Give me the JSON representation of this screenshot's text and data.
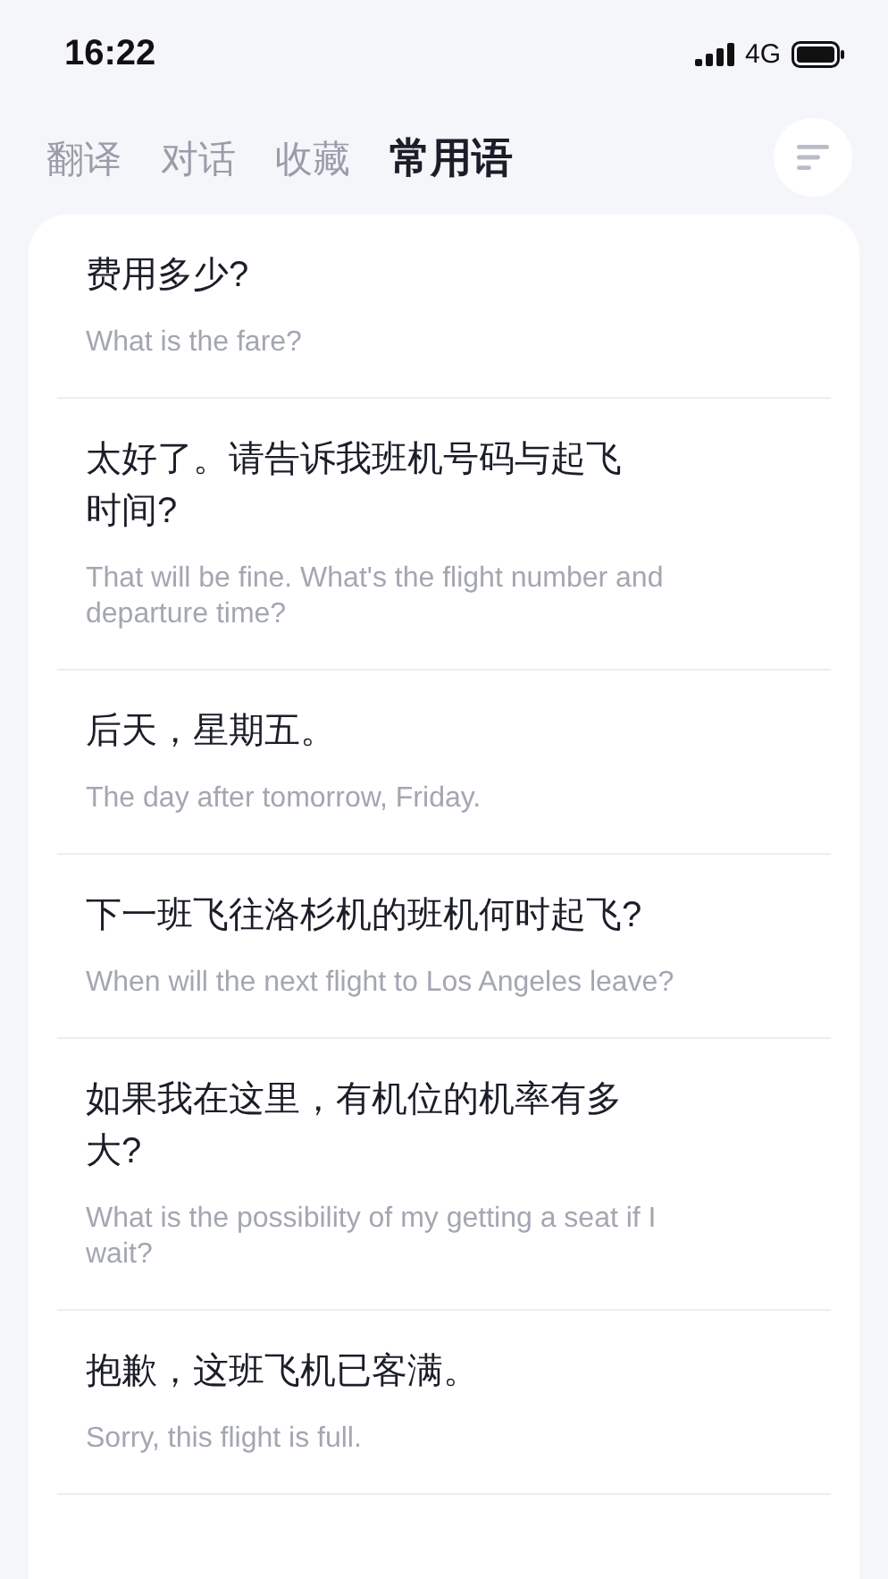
{
  "status_bar": {
    "time": "16:22",
    "network": "4G"
  },
  "tabs": [
    {
      "label": "翻译",
      "selected": false
    },
    {
      "label": "对话",
      "selected": false
    },
    {
      "label": "收藏",
      "selected": false
    },
    {
      "label": "常用语",
      "selected": true
    }
  ],
  "phrases": [
    {
      "chinese": "费用多少?",
      "english": "What is the fare?"
    },
    {
      "chinese": "太好了。请告诉我班机号码与起飞时间?",
      "english": "That will be fine. What's the flight number and departure time?"
    },
    {
      "chinese": "后天，星期五。",
      "english": "The day after tomorrow, Friday."
    },
    {
      "chinese": "下一班飞往洛杉机的班机何时起飞?",
      "english": "When will the next flight to Los Angeles leave?"
    },
    {
      "chinese": "如果我在这里，有机位的机率有多大?",
      "english": "What is the possibility of my getting a seat if I wait?"
    },
    {
      "chinese": "抱歉，这班飞机已客满。",
      "english": "Sorry, this flight is full."
    }
  ]
}
